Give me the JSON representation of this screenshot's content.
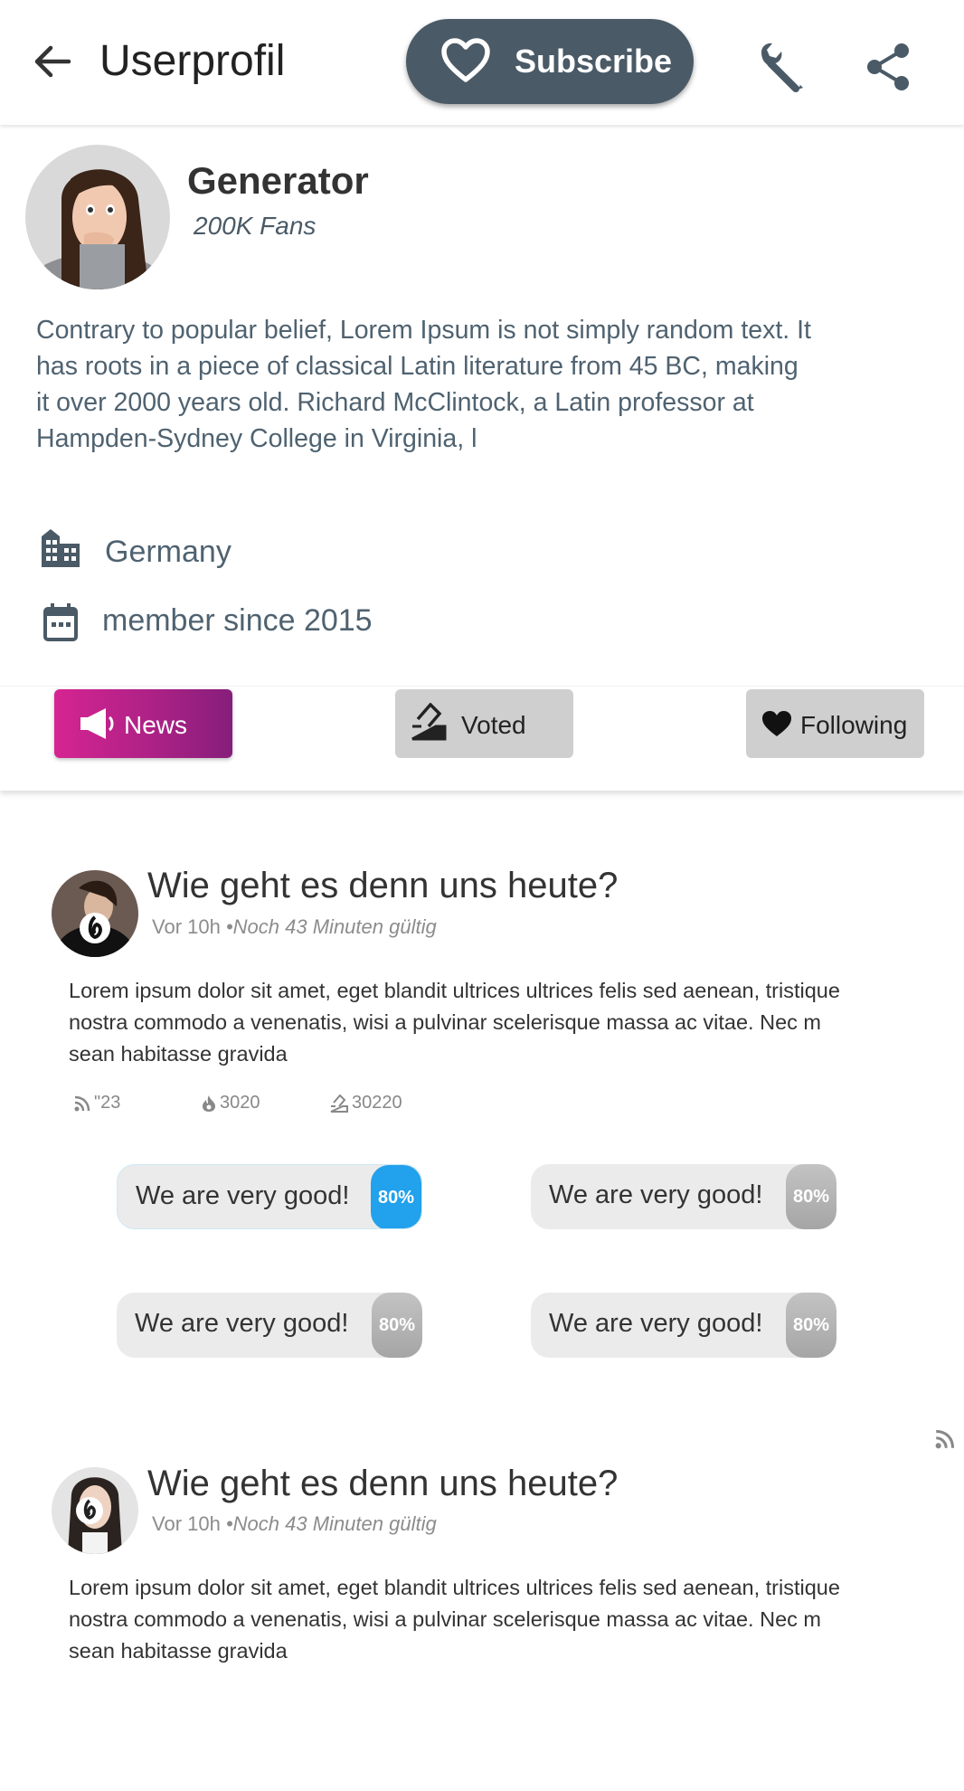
{
  "header": {
    "title": "Userprofil",
    "subscribe_label": "Subscribe",
    "icons": [
      "arrow-back-icon",
      "heart-outline-icon",
      "wrench-icon",
      "share-icon"
    ]
  },
  "profile": {
    "name": "Generator",
    "fans": "200K Fans",
    "bio": "Contrary to popular belief, Lorem Ipsum is not simply random text. It has roots in a piece of classical Latin literature from 45 BC, making it over 2000 years old. Richard McClintock, a Latin professor at Hampden-Sydney College in Virginia, l",
    "location": "Germany",
    "member_since": "member since 2015"
  },
  "tabs": [
    {
      "label": "News",
      "icon": "megaphone-icon",
      "active": true
    },
    {
      "label": "Voted",
      "icon": "ballot-box-icon",
      "active": false
    },
    {
      "label": "Following",
      "icon": "heart-icon",
      "active": false
    }
  ],
  "posts": [
    {
      "title": "Wie geht es denn uns heute?",
      "time": "Vor 10h",
      "validity": "•Noch 43 Minuten gültig",
      "body": "Lorem ipsum dolor sit amet, eget blandit ultrices ultrices felis sed aenean, tristique nostra commodo a venenatis, wisi a pulvinar scelerisque massa ac vitae. Nec m sean habitasse gravida",
      "stats": {
        "feed": "\"23",
        "hot": "3020",
        "votes": "30220"
      },
      "options": [
        {
          "label": "We are very good!",
          "percent": "80%",
          "selected": true
        },
        {
          "label": "We are very good!",
          "percent": "80%",
          "selected": false
        },
        {
          "label": "We are very good!",
          "percent": "80%",
          "selected": false
        },
        {
          "label": "We are very good!",
          "percent": "80%",
          "selected": false
        }
      ]
    },
    {
      "title": "Wie geht es denn uns heute?",
      "time": "Vor 10h",
      "validity": "•Noch 43 Minuten gültig",
      "body": "Lorem ipsum dolor sit amet, eget blandit ultrices ultrices felis sed aenean, tristique nostra commodo a venenatis, wisi a pulvinar scelerisque massa ac vitae. Nec m sean habitasse gravida"
    }
  ],
  "colors": {
    "subscribe_bg": "#4a5a66",
    "news_tab_start": "#d62491",
    "news_tab_end": "#861e7a",
    "inactive_tab": "#cfcfcf",
    "poll_selected": "#22a1ec",
    "poll_idle": "#b0b0b0",
    "text_secondary": "#4f6270"
  }
}
